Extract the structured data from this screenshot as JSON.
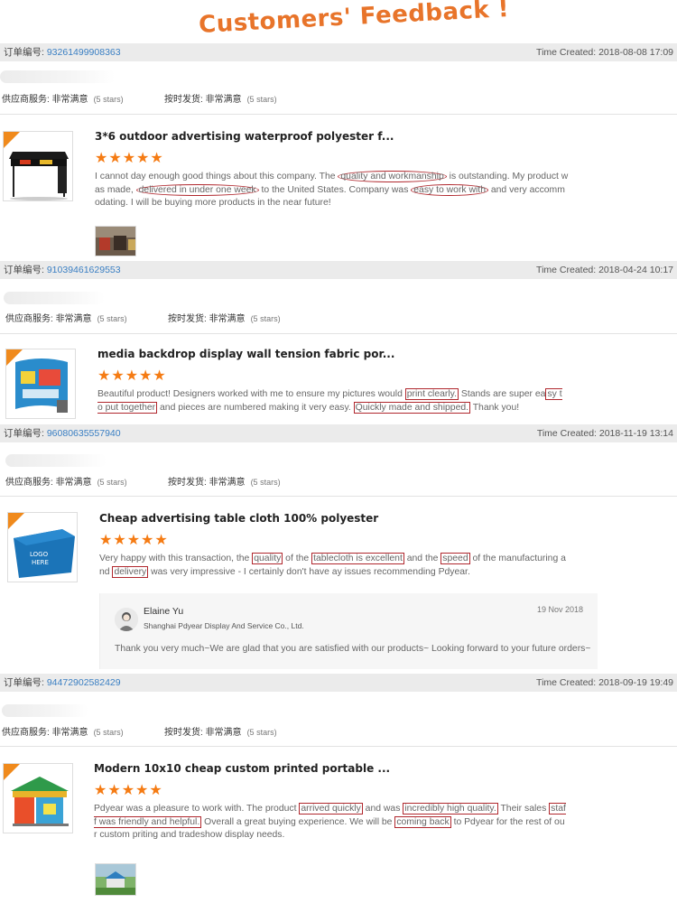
{
  "banner": {
    "title": "Customers' Feedback !"
  },
  "rating_labels": {
    "supplier_service": "供应商服务:",
    "on_time_delivery": "按时发货:",
    "value": "非常满意",
    "stars_text": "(5 stars)"
  },
  "stars_glyph": "★★★★★",
  "orders": [
    {
      "order_label": "订单编号:",
      "order_number": "93261499908363",
      "time_created": "Time Created: 2018-08-08 17:09",
      "product_title": "3*6 outdoor advertising waterproof polyester f...",
      "review": {
        "p1": "I cannot day enough good things about this company. The ",
        "h1": "quality and workmanship",
        "p2": " is outstanding. My product was made, ",
        "h2": "delivered in under one week",
        "p3": " to the United States. Company was ",
        "h3": "easy to work with",
        "p4": " and  very accommodating. I will be buying more products in the near future!"
      }
    },
    {
      "order_label": "订单编号:",
      "order_number": "91039461629553",
      "time_created": "Time Created: 2018-04-24 10:17",
      "product_title": "media backdrop display wall tension fabric por...",
      "review": {
        "p1": "Beautiful product! Designers worked with me to ensure my pictures would ",
        "h1": "print clearly.",
        "p2": " Stands are super ea",
        "h2": "sy to put together",
        "p3": " and pieces are numbered making it very easy. ",
        "h3": "Quickly made and shipped.",
        "p4": " Thank you!"
      }
    },
    {
      "order_label": "订单编号:",
      "order_number": "96080635557940",
      "time_created": "Time Created: 2018-11-19 13:14",
      "product_title": "Cheap advertising table cloth 100% polyester",
      "review": {
        "p1": "Very happy with this transaction, the ",
        "h1": "quality",
        "p2": " of the ",
        "h2": "tablecloth is excellent",
        "p3": " and the ",
        "h3": "speed",
        "p4": " of the manufacturing and ",
        "h4": "delivery",
        "p5": " was very impressive - I certainly don't have ay issues recommending Pdyear."
      },
      "reply": {
        "name": "Elaine Yu",
        "company": "Shanghai Pdyear Display And Service Co., Ltd.",
        "date": "19 Nov 2018",
        "text": "Thank you very much~We are glad that you are satisfied with our products~ Looking forward to your future orders~"
      }
    },
    {
      "order_label": "订单编号:",
      "order_number": "94472902582429",
      "time_created": "Time Created: 2018-09-19 19:49",
      "product_title": "Modern 10x10 cheap custom printed portable ...",
      "review": {
        "p1": "Pdyear was a pleasure to work with. The product ",
        "h1": "arrived quickly",
        "p2": " and was ",
        "h2": "incredibly high quality.",
        "p3": " Their sales ",
        "h3": "staff was friendly and helpful.",
        "p4": " Overall a great buying experience. We will be ",
        "h4": "coming back",
        "p5": " to Pdyear for the rest of our custom priting and tradeshow display needs."
      }
    }
  ],
  "colors": {
    "accent_orange": "#e8742a",
    "star_orange": "#f57b13",
    "order_link_blue": "#3a7fc3",
    "highlight_red": "#b0272d",
    "bar_gray": "#ebebeb"
  }
}
